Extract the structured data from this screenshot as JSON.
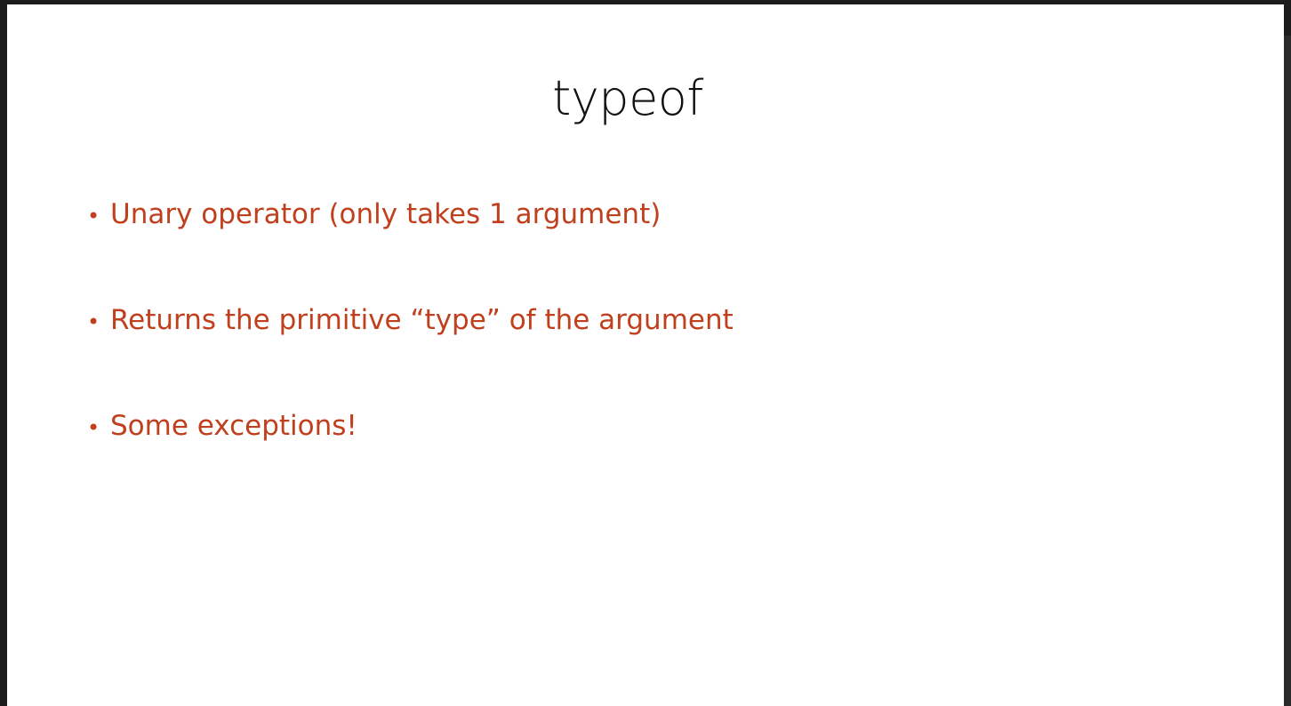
{
  "slide": {
    "title": "typeof",
    "bullet_symbol": "•",
    "bullets": [
      "Unary operator (only takes 1 argument)",
      "Returns the primitive “type” of the argument",
      "Some exceptions!"
    ]
  },
  "colors": {
    "title_text": "#111111",
    "bullet_text": "#c0401e",
    "slide_background": "#ffffff",
    "frame_background": "#1c1c1c"
  }
}
